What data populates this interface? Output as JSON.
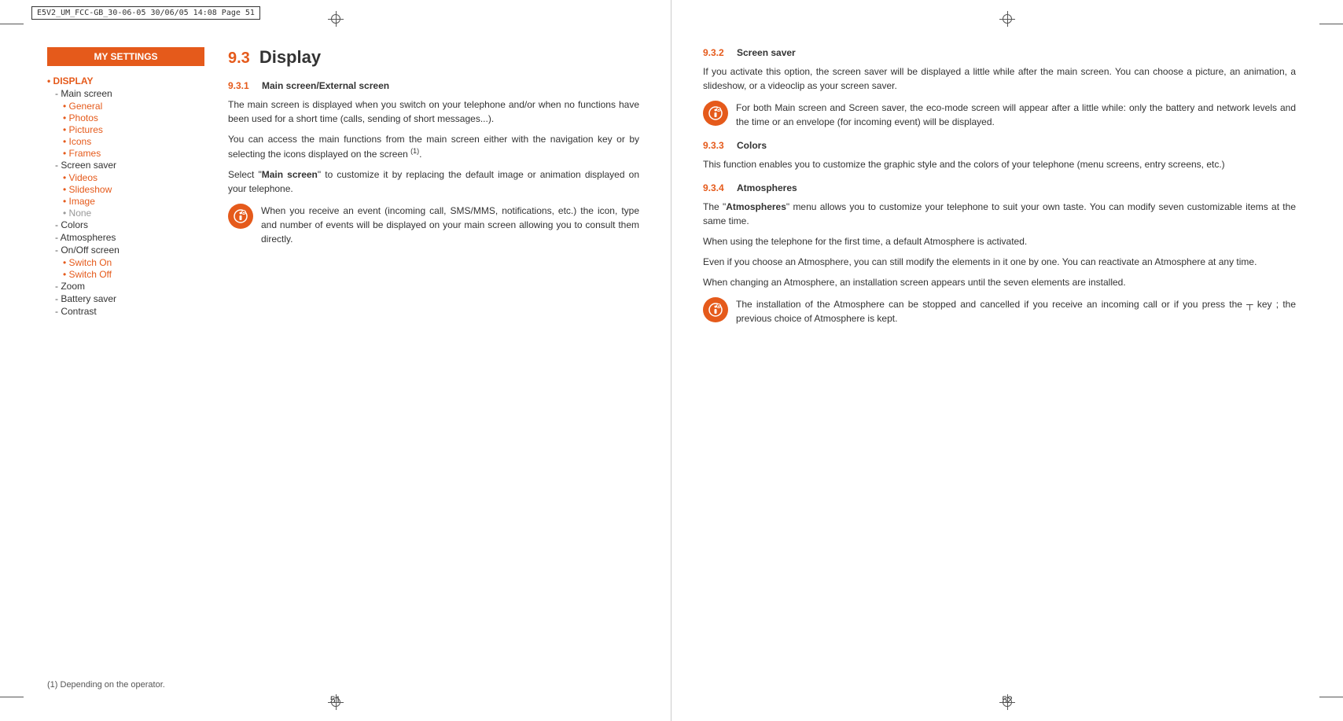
{
  "header": {
    "file_info": "E5V2_UM_FCC-GB_30-06-05    30/06/05   14:08    Page 51"
  },
  "sidebar": {
    "title": "MY SETTINGS",
    "category": "• DISPLAY",
    "items": [
      {
        "type": "dash",
        "label": "Main screen",
        "subitems": [
          "General",
          "Photos",
          "Pictures",
          "Icons",
          "Frames"
        ]
      },
      {
        "type": "dash",
        "label": "Screen saver",
        "subitems": [
          "Videos",
          "Slideshow",
          "Image",
          "None"
        ]
      },
      {
        "type": "dash",
        "label": "Colors",
        "subitems": []
      },
      {
        "type": "dash",
        "label": "Atmospheres",
        "subitems": []
      },
      {
        "type": "dash",
        "label": "On/Off screen",
        "subitems": [
          "Switch On",
          "Switch Off"
        ]
      },
      {
        "type": "dash",
        "label": "Zoom",
        "subitems": []
      },
      {
        "type": "dash",
        "label": "Battery saver",
        "subitems": []
      },
      {
        "type": "dash",
        "label": "Contrast",
        "subitems": []
      }
    ]
  },
  "left_page": {
    "section_num": "9.3",
    "section_title": "Display",
    "subsections": [
      {
        "num": "9.3.1",
        "title": "Main screen/External screen",
        "paragraphs": [
          "The main screen is displayed when you switch on your telephone and/or when no functions have been used for a short time (calls, sending of short messages...).",
          "You can access the main functions from the main screen either with the navigation key or by selecting the icons displayed on the screen (1).",
          "Select \"Main screen\" to customize it by replacing the default image or animation displayed on your telephone."
        ],
        "note": "When you receive an event (incoming call, SMS/MMS, notifications, etc.) the icon, type and number of events will be displayed on your main screen allowing you to consult them directly."
      }
    ],
    "footer_note": "(1)   Depending on the operator.",
    "page_num": "51"
  },
  "right_page": {
    "subsections": [
      {
        "num": "9.3.2",
        "title": "Screen saver",
        "paragraphs": [
          "If you activate this option, the screen saver  will be displayed a little while after the main screen. You can choose a picture, an animation, a slideshow, or  a videoclip as your screen saver."
        ],
        "note": "For both Main screen and Screen saver, the eco-mode screen will appear after a little while: only the battery and network levels and the time or an envelope (for incoming event) will be displayed."
      },
      {
        "num": "9.3.3",
        "title": "Colors",
        "paragraphs": [
          "This function enables you to customize the graphic style and the colors of your telephone (menu screens, entry screens, etc.)"
        ]
      },
      {
        "num": "9.3.4",
        "title": "Atmospheres",
        "paragraphs": [
          "The \"Atmospheres\" menu allows you to customize your telephone to suit your own taste. You can modify seven customizable items at the same time.",
          "When using the telephone for the first time, a default Atmosphere is activated.",
          "Even if you choose an Atmosphere, you can still modify the elements in it one by one. You can reactivate an Atmosphere at any time.",
          "When changing an Atmosphere, an installation screen appears until the seven elements are installed."
        ],
        "note": "The installation of the Atmosphere can be stopped and cancelled if you receive an incoming call or if you press the   key ; the previous choice of Atmosphere is kept."
      }
    ],
    "page_num": "52"
  },
  "icons": {
    "note_symbol": "🔔"
  }
}
